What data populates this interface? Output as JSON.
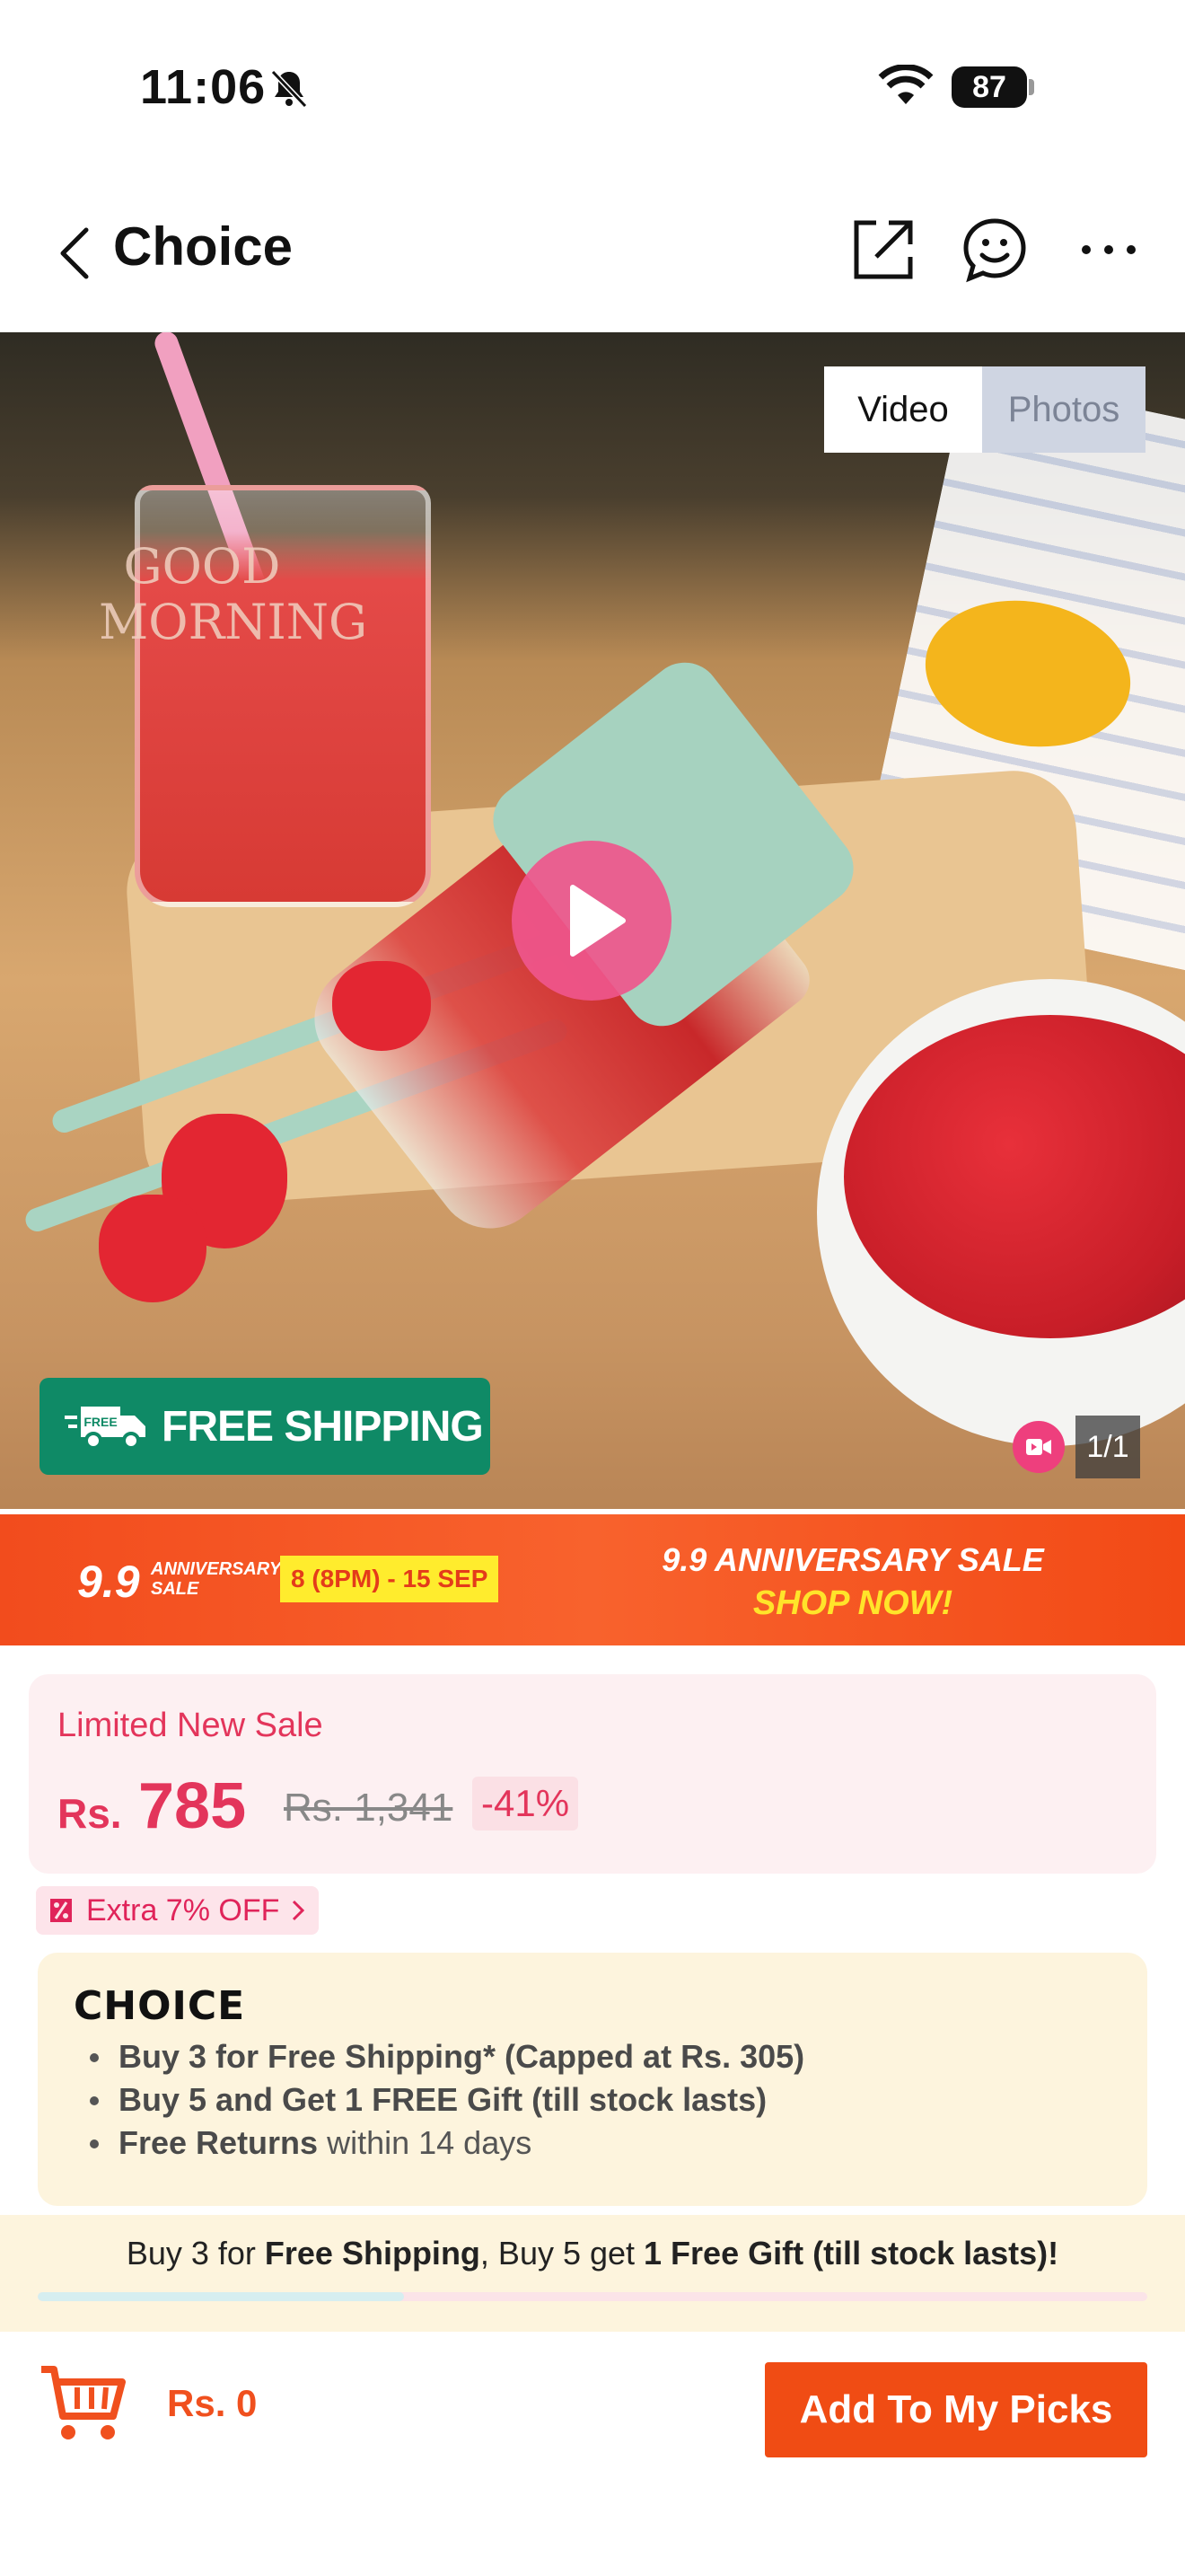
{
  "status_bar": {
    "time": "11:06",
    "battery": "87"
  },
  "header": {
    "title": "Choice"
  },
  "media": {
    "toggle_video": "Video",
    "toggle_photos": "Photos",
    "glass_text": "GOOD MORNING",
    "free_shipping": "FREE SHIPPING",
    "truck_badge": "FREE",
    "counter": "1/1"
  },
  "promo": {
    "logo": "9.9",
    "logo_sub": "ANNIVERSARY SALE",
    "date": "8 (8PM) - 15 SEP",
    "headline": "9.9 ANNIVERSARY SALE",
    "cta": "SHOP NOW!"
  },
  "price": {
    "label": "Limited New Sale",
    "currency": "Rs.",
    "amount": "785",
    "original": "Rs. 1,341",
    "discount": "-41%"
  },
  "coupon": {
    "label": "Extra 7% OFF"
  },
  "choice": {
    "logo": "CHOICE",
    "items": [
      {
        "bold": "Buy 3 for  Free Shipping* (Capped at Rs. 305)",
        "rest": ""
      },
      {
        "bold": "Buy 5 and Get 1 FREE Gift (till stock lasts)",
        "rest": ""
      },
      {
        "bold": "Free Returns",
        "rest": " within 14 days"
      }
    ]
  },
  "progress": {
    "t1": "Buy 3 for ",
    "b1": "Free Shipping",
    "t2": ", Buy 5 get ",
    "b2": "1 Free Gift (till stock lasts)!",
    "fill_percent": 33
  },
  "bottom": {
    "cart_total": "Rs. 0",
    "add_button": "Add To My Picks"
  },
  "colors": {
    "accent": "#f04c14",
    "sale": "#e3355b",
    "shipping_green": "#0f8a66",
    "choice_bg": "#fdf4dd"
  }
}
